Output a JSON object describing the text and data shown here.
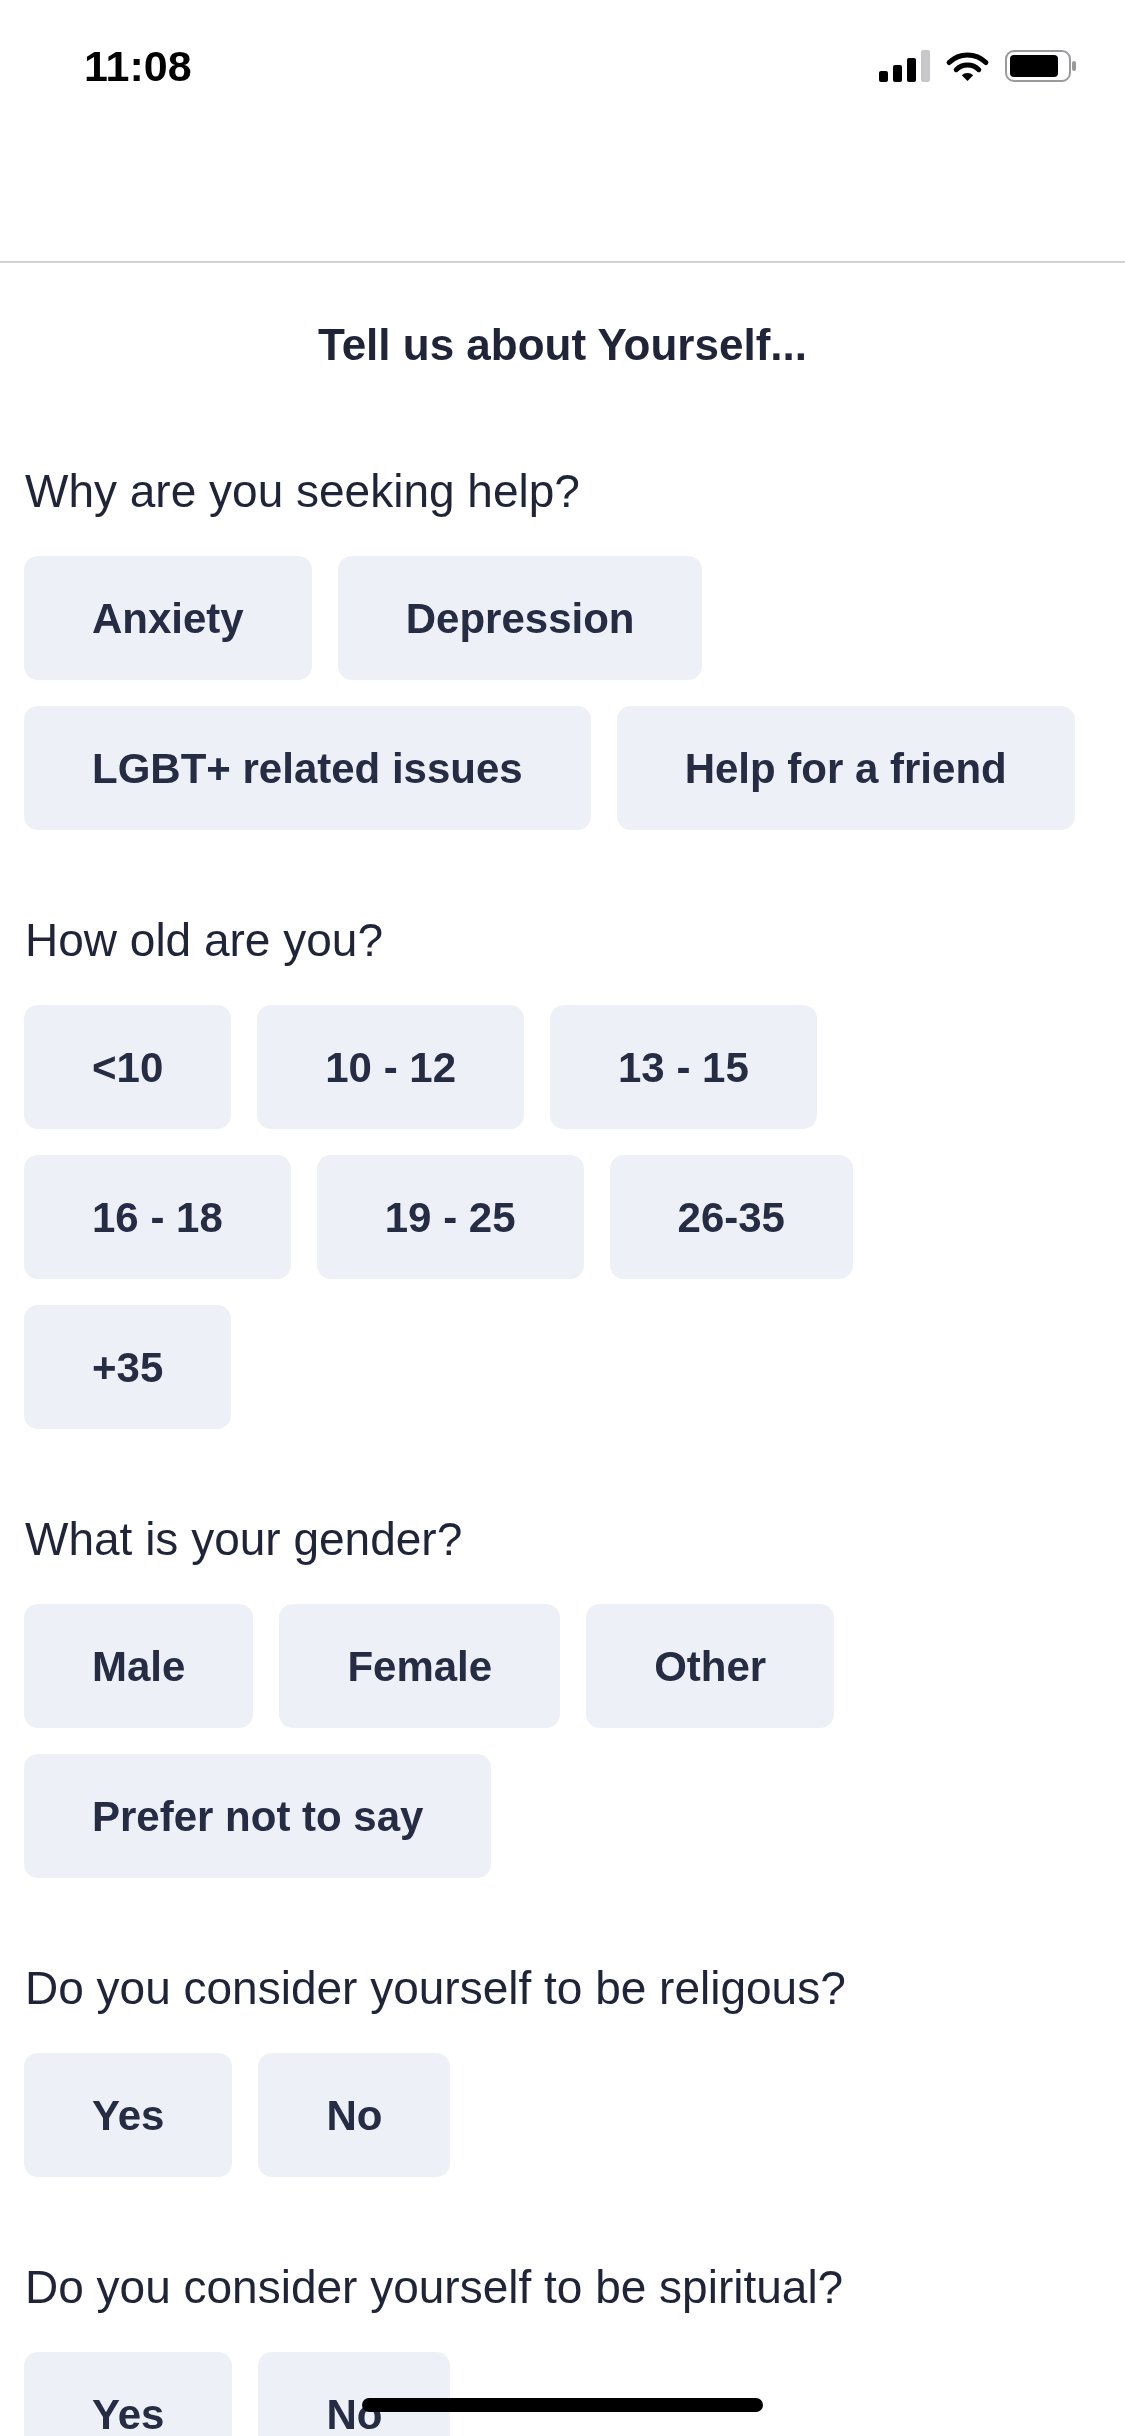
{
  "status_bar": {
    "time": "11:08"
  },
  "title": "Tell us about Yourself...",
  "questions": [
    {
      "text": "Why are you seeking help?",
      "options": [
        {
          "label": "Anxiety",
          "selected": false
        },
        {
          "label": "Depression",
          "selected": false
        },
        {
          "label": "LGBT+ related issues",
          "selected": false
        },
        {
          "label": "Help for a friend",
          "selected": false
        }
      ]
    },
    {
      "text": "How old are you?",
      "options": [
        {
          "label": "<10",
          "selected": false
        },
        {
          "label": "10 - 12",
          "selected": false
        },
        {
          "label": "13 - 15",
          "selected": false
        },
        {
          "label": "16 - 18",
          "selected": false
        },
        {
          "label": "19 - 25",
          "selected": false
        },
        {
          "label": "26-35",
          "selected": false
        },
        {
          "label": "+35",
          "selected": false
        }
      ]
    },
    {
      "text": "What is your gender?",
      "options": [
        {
          "label": "Male",
          "selected": false
        },
        {
          "label": "Female",
          "selected": false
        },
        {
          "label": "Other",
          "selected": false
        },
        {
          "label": "Prefer not to say",
          "selected": false
        }
      ]
    },
    {
      "text": "Do you consider yourself to be religous?",
      "options": [
        {
          "label": "Yes",
          "selected": false
        },
        {
          "label": "No",
          "selected": false
        }
      ]
    },
    {
      "text": "Do you consider yourself to be spiritual?",
      "options": [
        {
          "label": "Yes",
          "selected": false
        },
        {
          "label": "No",
          "selected": false
        }
      ]
    }
  ]
}
